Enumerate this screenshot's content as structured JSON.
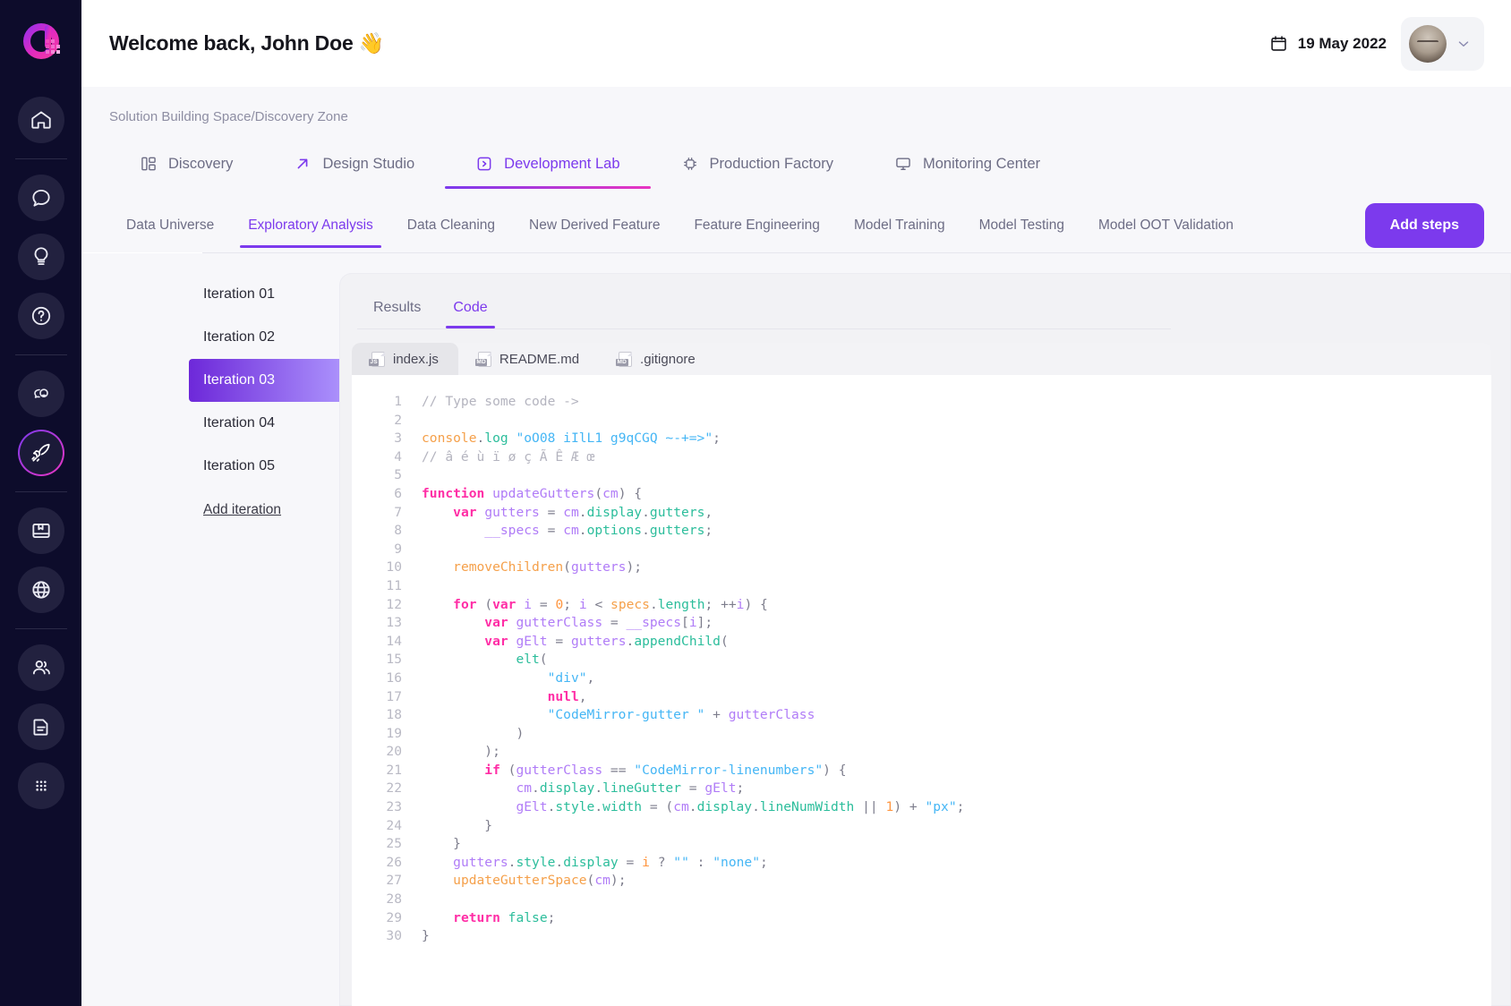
{
  "sidebar": {
    "logo_name": "brand-logo",
    "items": [
      {
        "name": "home",
        "icon": "home-icon",
        "active": false
      },
      {
        "name": "chat",
        "icon": "speech-bubble-icon",
        "active": false
      },
      {
        "name": "ideas",
        "icon": "lightbulb-icon",
        "active": false
      },
      {
        "name": "help",
        "icon": "question-circle-icon",
        "active": false
      },
      {
        "name": "insights",
        "icon": "brain-idea-icon",
        "active": false
      },
      {
        "name": "launch",
        "icon": "rocket-icon",
        "active": true
      },
      {
        "name": "library",
        "icon": "book-icon",
        "active": false
      },
      {
        "name": "global",
        "icon": "globe-icon",
        "active": false
      },
      {
        "name": "teams",
        "icon": "people-icon",
        "active": false
      },
      {
        "name": "documents",
        "icon": "document-icon",
        "active": false
      },
      {
        "name": "apps",
        "icon": "grid-dots-icon",
        "active": false
      }
    ]
  },
  "header": {
    "greeting": "Welcome back, John Doe 👋",
    "date": "19 May 2022",
    "calendar_icon": "calendar-icon",
    "chevron_icon": "chevron-down-icon"
  },
  "breadcrumb": "Solution Building Space/Discovery Zone",
  "primary_tabs": [
    {
      "label": "Discovery",
      "icon": "layout-panels-icon",
      "active": false
    },
    {
      "label": "Design Studio",
      "icon": "arrow-up-right-icon",
      "active": false
    },
    {
      "label": "Development Lab",
      "icon": "code-play-icon",
      "active": true
    },
    {
      "label": "Production Factory",
      "icon": "chip-icon",
      "active": false
    },
    {
      "label": "Monitoring Center",
      "icon": "monitor-icon",
      "active": false
    }
  ],
  "secondary_tabs": [
    {
      "label": "Data Universe",
      "active": false
    },
    {
      "label": "Exploratory Analysis",
      "active": true
    },
    {
      "label": "Data Cleaning",
      "active": false
    },
    {
      "label": "New Derived Feature",
      "active": false
    },
    {
      "label": "Feature Engineering",
      "active": false
    },
    {
      "label": "Model Training",
      "active": false
    },
    {
      "label": "Model Testing",
      "active": false
    },
    {
      "label": "Model OOT Validation",
      "active": false
    }
  ],
  "add_steps_label": "Add steps",
  "iterations": {
    "items": [
      {
        "label": "Iteration 01",
        "active": false
      },
      {
        "label": "Iteration 02",
        "active": false
      },
      {
        "label": "Iteration 03",
        "active": true
      },
      {
        "label": "Iteration 04",
        "active": false
      },
      {
        "label": "Iteration 05",
        "active": false
      }
    ],
    "add_label": "Add iteration"
  },
  "panel": {
    "tabs": [
      {
        "label": "Results",
        "active": false
      },
      {
        "label": "Code",
        "active": true
      }
    ],
    "files": [
      {
        "label": "index.js",
        "badge": "JS",
        "active": true
      },
      {
        "label": "README.md",
        "badge": "MD",
        "active": false
      },
      {
        "label": ".gitignore",
        "badge": "MD",
        "active": false
      }
    ]
  },
  "code": {
    "lines": [
      "1",
      "2",
      "3",
      "4",
      "5",
      "6",
      "7",
      "8",
      "9",
      "10",
      "11",
      "12",
      "13",
      "14",
      "15",
      "16",
      "17",
      "18",
      "19",
      "20",
      "21",
      "22",
      "23",
      "24",
      "25",
      "26",
      "27",
      "28",
      "29",
      "30"
    ],
    "text": [
      "// Type some code ->",
      "",
      "console.log \"oO08 iIlL1 g9qCGQ ~-+=>\";",
      "// â é ù ï ø ç Ã Ê Æ œ",
      "",
      "function updateGutters(cm) {",
      "    var gutters = cm.display.gutters,",
      "        __specs = cm.options.gutters;",
      "",
      "    removeChildren(gutters);",
      "",
      "    for (var i = 0; i < specs.length; ++i) {",
      "        var gutterClass = __specs[i];",
      "        var gElt = gutters.appendChild(",
      "            elt(",
      "                \"div\",",
      "                null,",
      "                \"CodeMirror-gutter \" + gutterClass",
      "            )",
      "        );",
      "        if (gutterClass == \"CodeMirror-linenumbers\") {",
      "            cm.display.lineGutter = gElt;",
      "            gElt.style.width = (cm.display.lineNumWidth || 1) + \"px\";",
      "        }",
      "    }",
      "    gutters.style.display = i ? \"\" : \"none\";",
      "    updateGutterSpace(cm);",
      "",
      "    return false;",
      "}"
    ]
  },
  "colors": {
    "accent": "#7c3aed",
    "accent_pink": "#e935c1",
    "sidebar_bg": "#0d0c2b",
    "page_bg": "#f7f7fa",
    "text": "#2c2c38",
    "muted": "#6d6d85"
  }
}
